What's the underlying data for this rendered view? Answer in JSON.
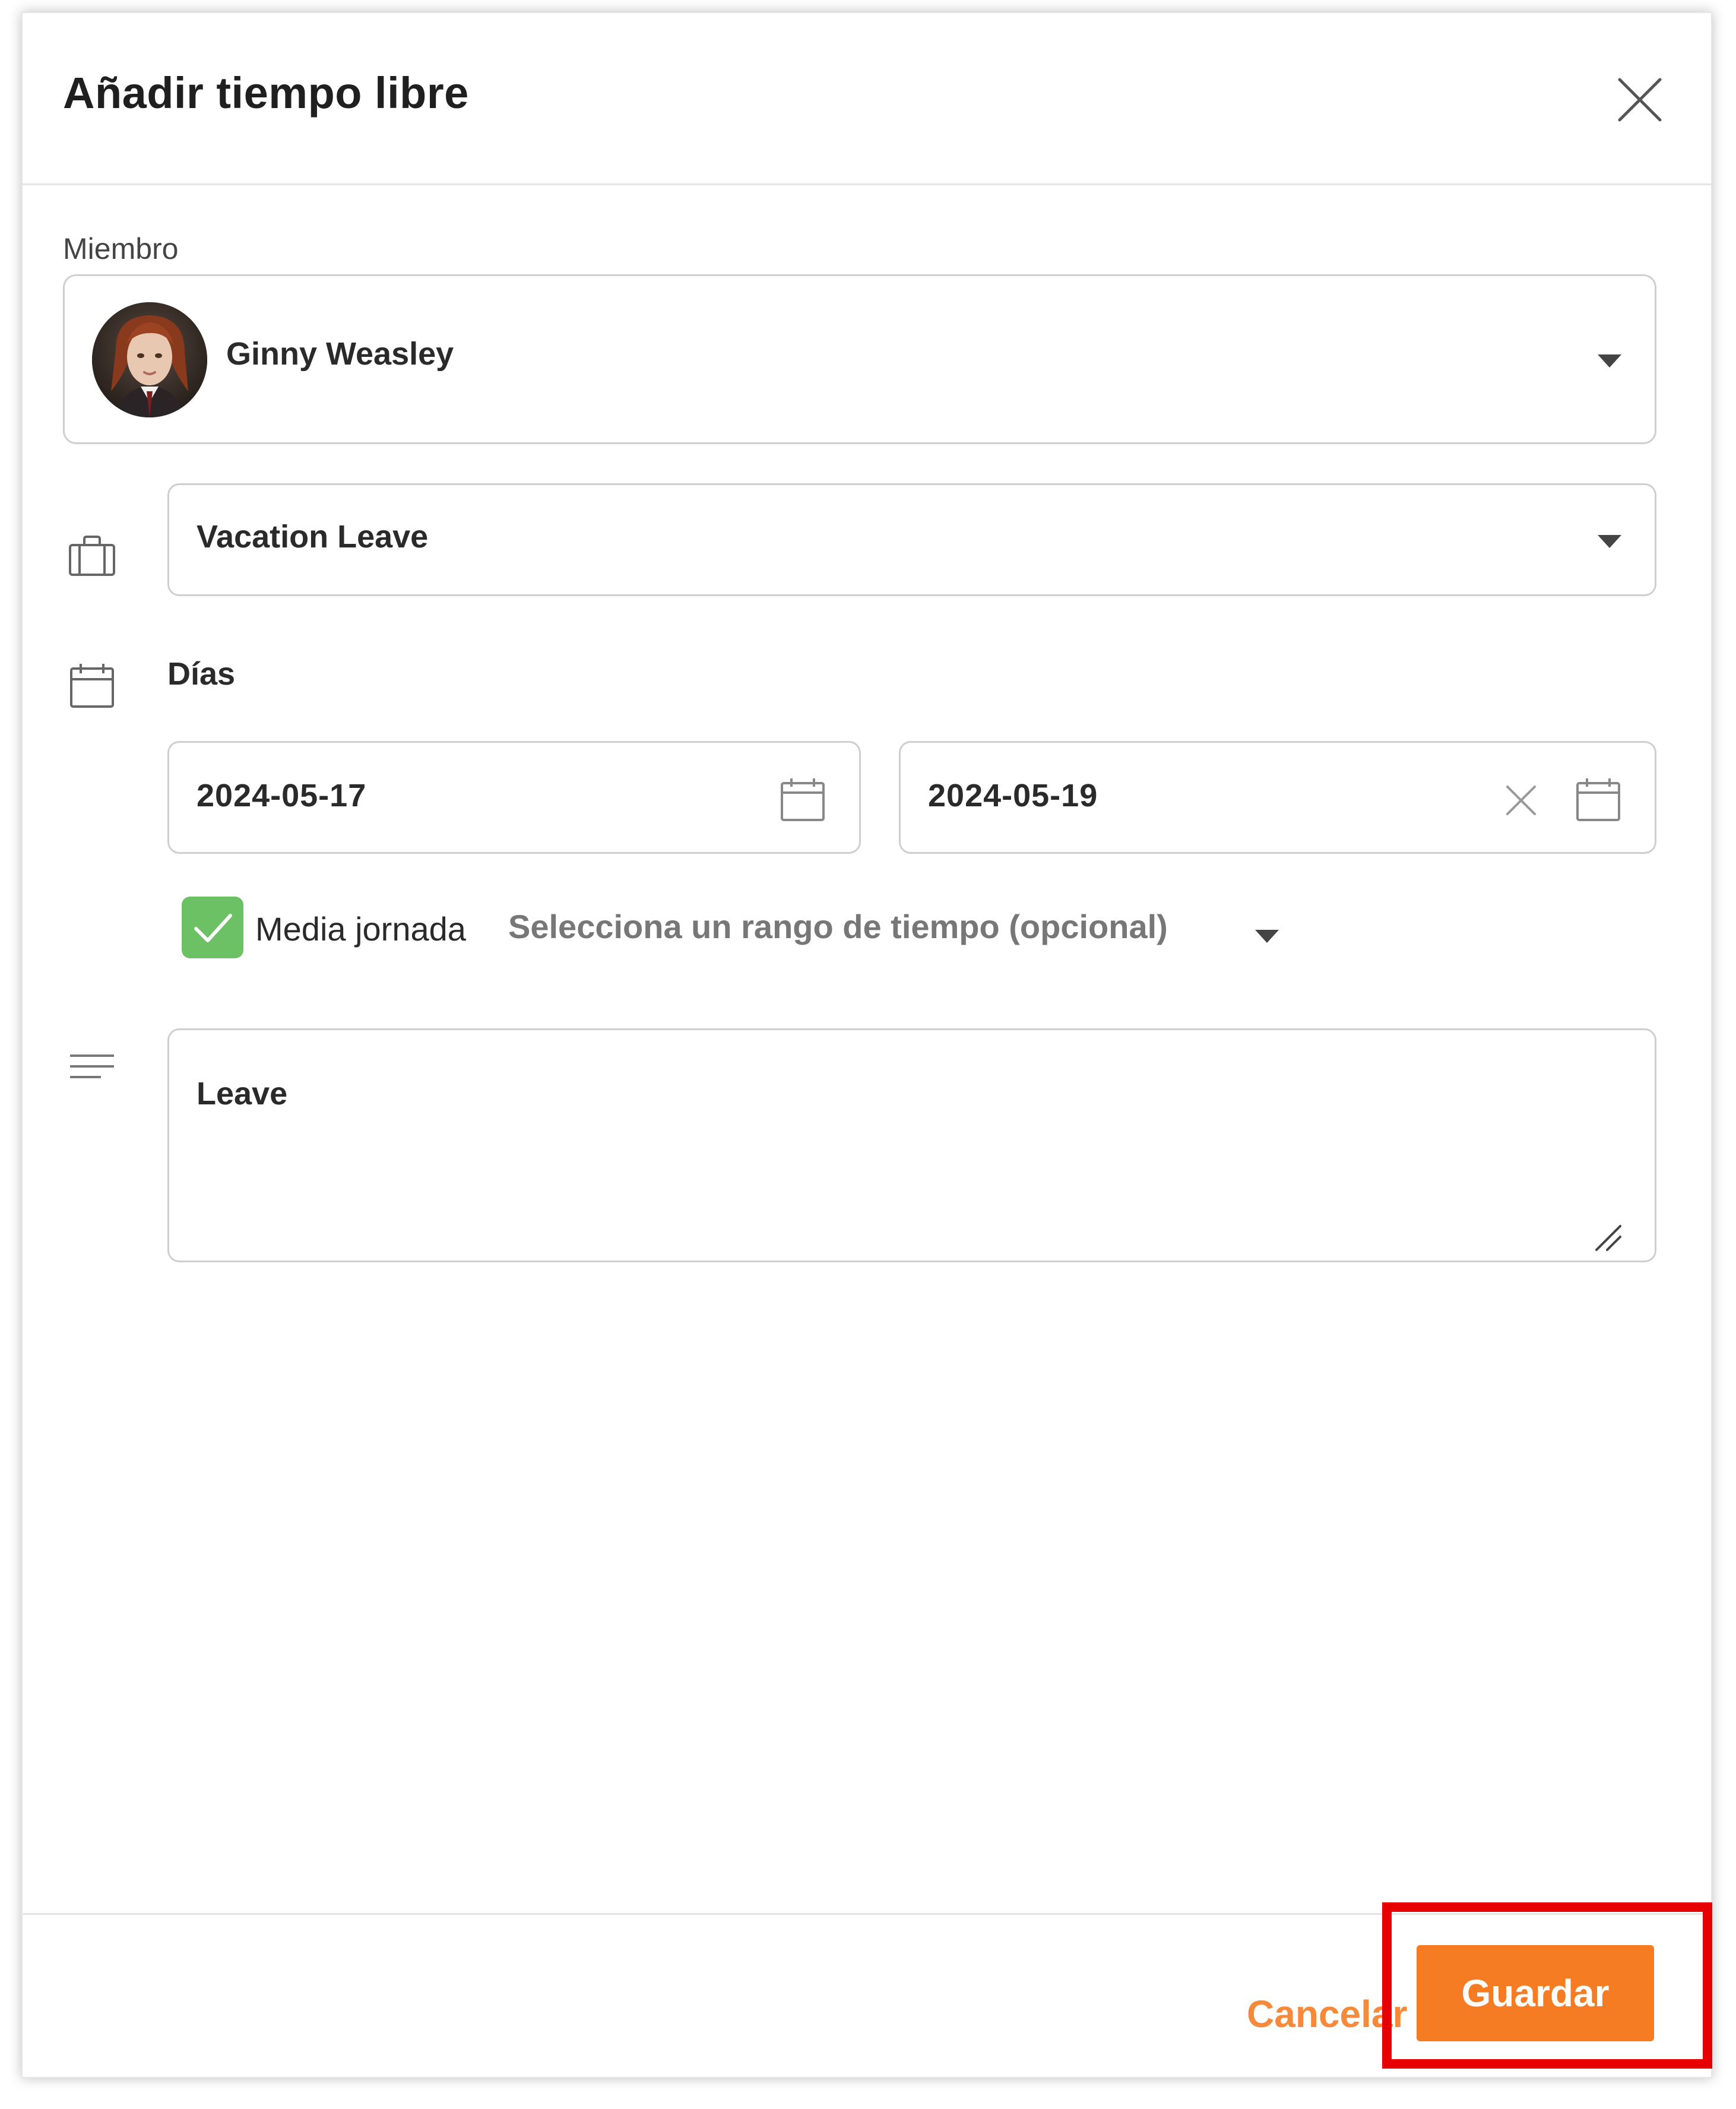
{
  "modal": {
    "title": "Añadir tiempo libre",
    "close_icon": "close-icon"
  },
  "member": {
    "label": "Miembro",
    "selected_name": "Ginny Weasley",
    "avatar_icon": "avatar"
  },
  "leave_type": {
    "icon": "briefcase-icon",
    "selected": "Vacation Leave"
  },
  "days": {
    "icon": "calendar-icon",
    "label": "Días",
    "start_date": "2024-05-17",
    "end_date": "2024-05-19"
  },
  "half_day": {
    "checked": true,
    "label": "Media jornada",
    "time_range_placeholder": "Selecciona un rango de tiempo (opcional)"
  },
  "notes": {
    "icon": "notes-icon",
    "value": "Leave"
  },
  "footer": {
    "cancel_label": "Cancelar",
    "save_label": "Guardar"
  },
  "colors": {
    "accent": "#f57c22",
    "cancel_text": "#f7893a",
    "checkbox": "#6cc164",
    "highlight": "#e80000"
  }
}
